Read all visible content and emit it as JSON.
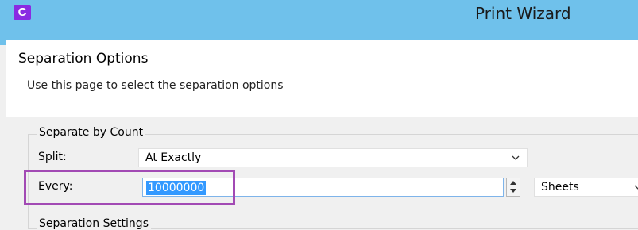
{
  "window": {
    "app_icon_letter": "C",
    "title": "Print Wizard"
  },
  "header": {
    "page_title": "Separation Options",
    "description": "Use this page to select the separation options"
  },
  "separate_by_count": {
    "legend": "Separate by Count",
    "split": {
      "label": "Split:",
      "value": "At Exactly"
    },
    "every": {
      "label": "Every:",
      "value": "10000000",
      "unit": "Sheets"
    }
  },
  "separation_settings": {
    "legend": "Separation Settings"
  },
  "colors": {
    "titlebar": "#6fc1eb",
    "app_icon": "#8a2be2",
    "highlight_box": "#a24ab4",
    "selection": "#3399ff"
  },
  "icons": [
    "app-icon",
    "chevron-down-icon",
    "spin-up-icon",
    "spin-down-icon"
  ]
}
